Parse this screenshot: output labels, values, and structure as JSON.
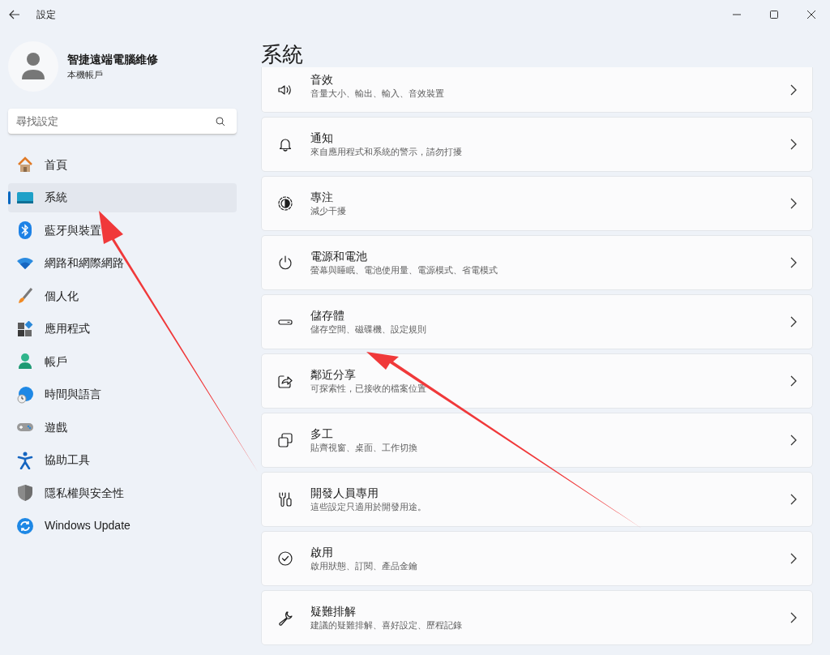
{
  "window": {
    "title": "設定"
  },
  "account": {
    "name": "智捷遠端電腦維修",
    "type": "本機帳戶"
  },
  "search": {
    "placeholder": "尋找設定"
  },
  "sidebar": {
    "items": [
      {
        "label": "首頁",
        "selected": false
      },
      {
        "label": "系統",
        "selected": true
      },
      {
        "label": "藍牙與裝置",
        "selected": false
      },
      {
        "label": "網路和網際網路",
        "selected": false
      },
      {
        "label": "個人化",
        "selected": false
      },
      {
        "label": "應用程式",
        "selected": false
      },
      {
        "label": "帳戶",
        "selected": false
      },
      {
        "label": "時間與語言",
        "selected": false
      },
      {
        "label": "遊戲",
        "selected": false
      },
      {
        "label": "協助工具",
        "selected": false
      },
      {
        "label": "隱私權與安全性",
        "selected": false
      },
      {
        "label": "Windows Update",
        "selected": false
      }
    ]
  },
  "page": {
    "title": "系統",
    "settings": [
      {
        "title": "音效",
        "description": "音量大小、輸出、輸入、音效裝置"
      },
      {
        "title": "通知",
        "description": "來自應用程式和系統的警示，請勿打擾"
      },
      {
        "title": "專注",
        "description": "減少干擾"
      },
      {
        "title": "電源和電池",
        "description": "螢幕與睡眠、電池使用量、電源模式、省電模式"
      },
      {
        "title": "儲存體",
        "description": "儲存空間、磁碟機、設定規則"
      },
      {
        "title": "鄰近分享",
        "description": "可探索性，已接收的檔案位置"
      },
      {
        "title": "多工",
        "description": "貼齊視窗、桌面、工作切換"
      },
      {
        "title": "開發人員專用",
        "description": "這些設定只適用於開發用途。"
      },
      {
        "title": "啟用",
        "description": "啟用狀態、訂閱、產品金鑰"
      },
      {
        "title": "疑難排解",
        "description": "建議的疑難排解、喜好設定、歷程記錄"
      }
    ]
  }
}
